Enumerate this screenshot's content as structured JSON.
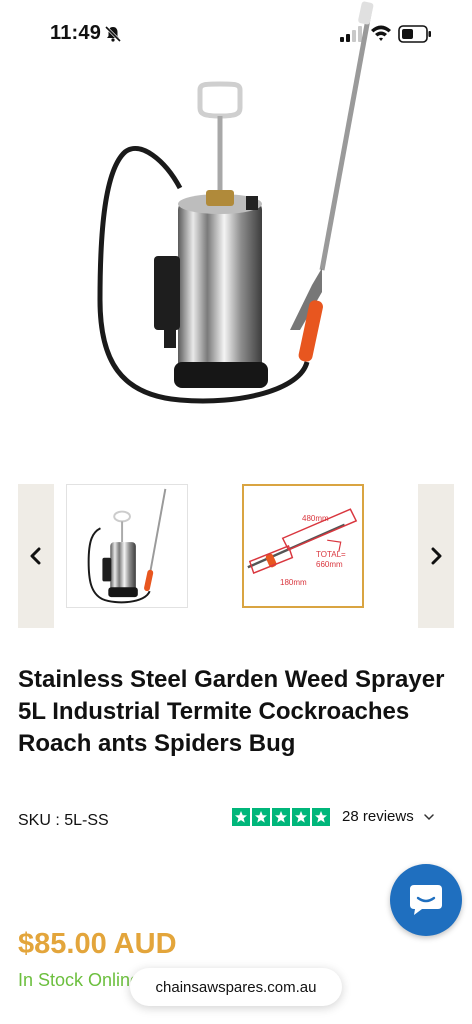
{
  "status_bar": {
    "time": "11:49"
  },
  "product": {
    "title": "Stainless Steel Garden Weed Sprayer 5L Industrial Termite Cockroaches Roach ants Spiders Bug",
    "sku": "SKU : 5L-SS",
    "rating_stars": 5,
    "reviews_label": "28 reviews",
    "price": "$85.00 AUD",
    "stock": "In Stock Online"
  },
  "thumbnail_2": {
    "dim_length": "480mm",
    "dim_handle": "180mm",
    "dim_total": "TOTAL= 660mm"
  },
  "browser": {
    "url": "chainsawspares.com.au"
  },
  "colors": {
    "price": "#e3a53b",
    "stock": "#6cbf3e",
    "trustpilot": "#00b67a",
    "chat": "#1f6fbf",
    "thumb_border": "#d9a441"
  },
  "icons": [
    "bell-muted-icon",
    "signal-icon",
    "wifi-icon",
    "battery-icon",
    "chevron-left-icon",
    "chevron-right-icon",
    "star-icon",
    "chevron-down-icon",
    "chat-icon"
  ]
}
